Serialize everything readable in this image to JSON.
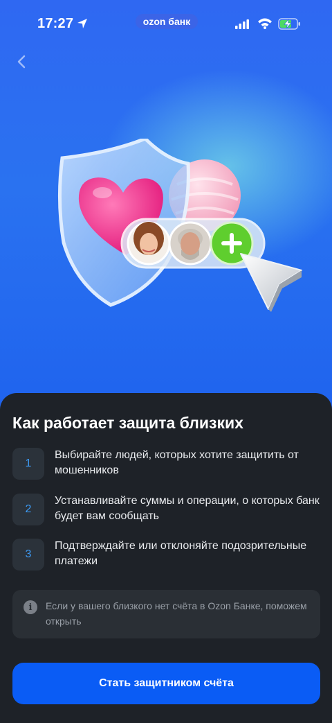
{
  "status_bar": {
    "time": "17:27",
    "brand": "ozon банк",
    "icons": [
      "location-arrow-icon",
      "cellular-signal-icon",
      "wifi-icon",
      "battery-charging-icon"
    ]
  },
  "nav": {
    "back_icon": "chevron-left-icon"
  },
  "illustration": {
    "description_icons": [
      "shield-icon",
      "heart-icon",
      "avatar-woman",
      "avatar-man",
      "plus-icon",
      "cursor-arrow-icon"
    ]
  },
  "sheet": {
    "title": "Как работает защита близких",
    "steps": [
      {
        "number": "1",
        "text": "Выбирайте людей, которых хотите защитить от мошенников"
      },
      {
        "number": "2",
        "text": "Устанавливайте суммы и операции, о которых банк будет вам сообщать"
      },
      {
        "number": "3",
        "text": "Подтверждайте или отклоняйте подозрительные платежи"
      }
    ],
    "info": {
      "icon": "info-icon",
      "text": "Если у вашего близкого нет счёта в Ozon Банке, поможем открыть"
    },
    "cta_label": "Стать защитником счёта"
  },
  "colors": {
    "hero_blue": "#2a6df1",
    "sheet_bg": "#1e2228",
    "step_number": "#3d9bf5",
    "cta_bg": "#0a5cf5"
  }
}
